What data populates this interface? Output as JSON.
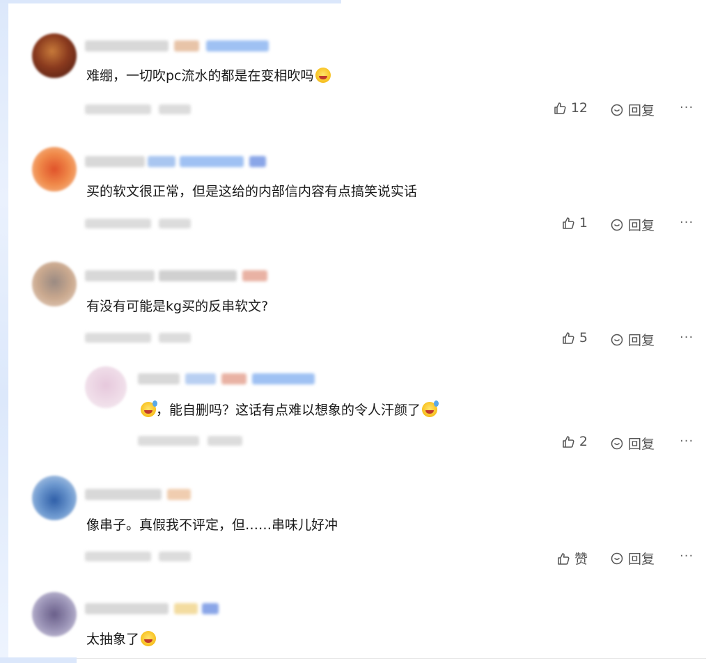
{
  "colors": {
    "text": "#1a1a1a",
    "muted": "#555555",
    "accent": "#dbe7fb"
  },
  "comments": [
    {
      "text": "难绷，一切吹pc流水的都是在变相吹吗",
      "emoji": "smirk-emoji",
      "likes": "12",
      "reply_label": "回复",
      "more_label": "···"
    },
    {
      "text": "买的软文很正常，但是这给的内部信内容有点搞笑说实话",
      "likes": "1",
      "reply_label": "回复",
      "more_label": "···"
    },
    {
      "text": "有没有可能是kg买的反串软文?",
      "likes": "5",
      "reply_label": "回复",
      "more_label": "···"
    },
    {
      "text": "，能自删吗？这话有点难以想象的令人汗颜了",
      "emoji_before": "sweat-smile-emoji",
      "emoji_after": "sweat-smile-emoji",
      "likes": "2",
      "reply_label": "回复",
      "more_label": "···",
      "is_reply": true
    },
    {
      "text": "像串子。真假我不评定，但……串味儿好冲",
      "likes": "赞",
      "reply_label": "回复",
      "more_label": "···"
    },
    {
      "text": "太抽象了",
      "emoji": "astonished-emoji"
    }
  ]
}
